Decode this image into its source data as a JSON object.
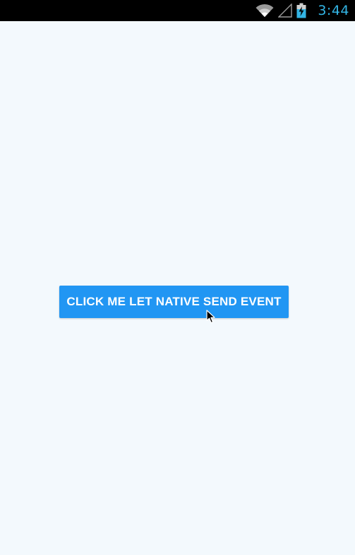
{
  "status_bar": {
    "time": "3:44",
    "icons": [
      "wifi-icon",
      "cell-signal-icon",
      "battery-charging-icon"
    ],
    "clock_color": "#33b5e5"
  },
  "main": {
    "button_label": "Click me let native send event",
    "button_color": "#2196f3",
    "background_color": "#f3f9fd"
  }
}
